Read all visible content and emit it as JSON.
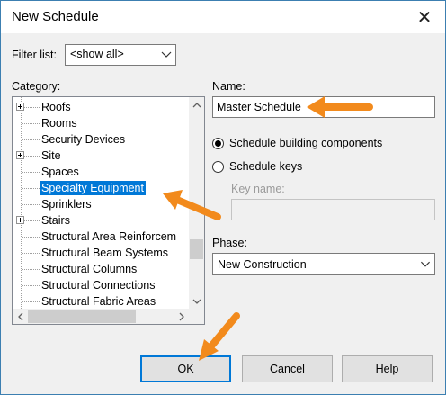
{
  "window": {
    "title": "New Schedule",
    "close_glyph": "✕"
  },
  "filter": {
    "label": "Filter list:",
    "value": "<show all>"
  },
  "category": {
    "label": "Category:",
    "items": [
      {
        "label": "Roofs",
        "expandable": true,
        "selected": false
      },
      {
        "label": "Rooms",
        "expandable": false,
        "selected": false
      },
      {
        "label": "Security Devices",
        "expandable": false,
        "selected": false
      },
      {
        "label": "Site",
        "expandable": true,
        "selected": false
      },
      {
        "label": "Spaces",
        "expandable": false,
        "selected": false
      },
      {
        "label": "Specialty Equipment",
        "expandable": false,
        "selected": true
      },
      {
        "label": "Sprinklers",
        "expandable": false,
        "selected": false
      },
      {
        "label": "Stairs",
        "expandable": true,
        "selected": false
      },
      {
        "label": "Structural Area Reinforcem",
        "expandable": false,
        "selected": false
      },
      {
        "label": "Structural Beam Systems",
        "expandable": false,
        "selected": false
      },
      {
        "label": "Structural Columns",
        "expandable": false,
        "selected": false
      },
      {
        "label": "Structural Connections",
        "expandable": false,
        "selected": false
      },
      {
        "label": "Structural Fabric Areas",
        "expandable": false,
        "selected": false
      }
    ]
  },
  "name": {
    "label": "Name:",
    "value": "Master Schedule"
  },
  "schedule_type": {
    "option_components": {
      "label": "Schedule building components",
      "checked": true
    },
    "option_keys": {
      "label": "Schedule keys",
      "checked": false
    },
    "key_name_label": "Key name:",
    "key_name_value": ""
  },
  "phase": {
    "label": "Phase:",
    "value": "New Construction"
  },
  "buttons": {
    "ok": "OK",
    "cancel": "Cancel",
    "help": "Help"
  },
  "colors": {
    "accent": "#0078d7",
    "annotation_arrow": "#f28a1c"
  }
}
